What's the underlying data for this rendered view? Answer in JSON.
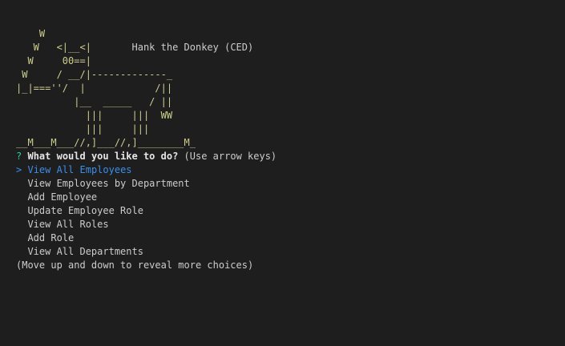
{
  "banner": {
    "lines": [
      "    W",
      "   W   <|__<|       ",
      "  W     00==|",
      " W     / __/|-------------_",
      "|_|===''/  |            /||",
      "          |__  _____   / ||",
      "            |||     |||  WW",
      "            |||     |||",
      "__M___M___//,]___//,]________M_"
    ],
    "title": "Hank the Donkey (CED)"
  },
  "prompt": {
    "mark": "?",
    "question": "What would you like to do?",
    "hint": "(Use arrow keys)"
  },
  "menu": {
    "pointer": ">",
    "items": [
      {
        "label": "View All Employees",
        "selected": true
      },
      {
        "label": "View Employees by Department",
        "selected": false
      },
      {
        "label": "Add Employee",
        "selected": false
      },
      {
        "label": "Update Employee Role",
        "selected": false
      },
      {
        "label": "View All Roles",
        "selected": false
      },
      {
        "label": "Add Role",
        "selected": false
      },
      {
        "label": "View All Departments",
        "selected": false
      }
    ]
  },
  "footer": {
    "note": "(Move up and down to reveal more choices)"
  },
  "colors": {
    "background": "#1e1e1e",
    "art": "#cdcd8f",
    "prompt_mark": "#23d18b",
    "selected": "#3b8eea",
    "text": "#cccccc"
  }
}
